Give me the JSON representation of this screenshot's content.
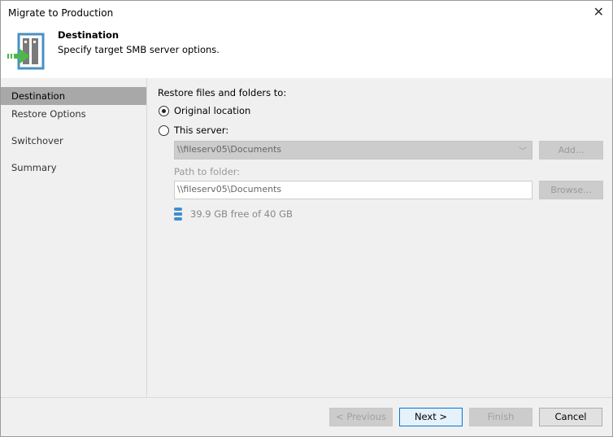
{
  "window": {
    "title": "Migrate to Production"
  },
  "header": {
    "title": "Destination",
    "subtitle": "Specify target SMB server options."
  },
  "sidebar": {
    "items": [
      {
        "label": "Destination",
        "selected": true
      },
      {
        "label": "Restore Options"
      },
      {
        "label": "Switchover"
      },
      {
        "label": "Summary"
      }
    ]
  },
  "main": {
    "restore_label": "Restore files and folders to:",
    "options": [
      {
        "label": "Original location",
        "checked": true
      },
      {
        "label": "This server:",
        "checked": false
      }
    ],
    "server_value": "\\\\fileserv05\\Documents",
    "add_label": "Add...",
    "path_label": "Path to folder:",
    "path_value": "\\\\fileserv05\\Documents",
    "browse_label": "Browse...",
    "free_space": "39.9 GB free of 40 GB"
  },
  "footer": {
    "previous": "< Previous",
    "next": "Next >",
    "finish": "Finish",
    "cancel": "Cancel"
  }
}
